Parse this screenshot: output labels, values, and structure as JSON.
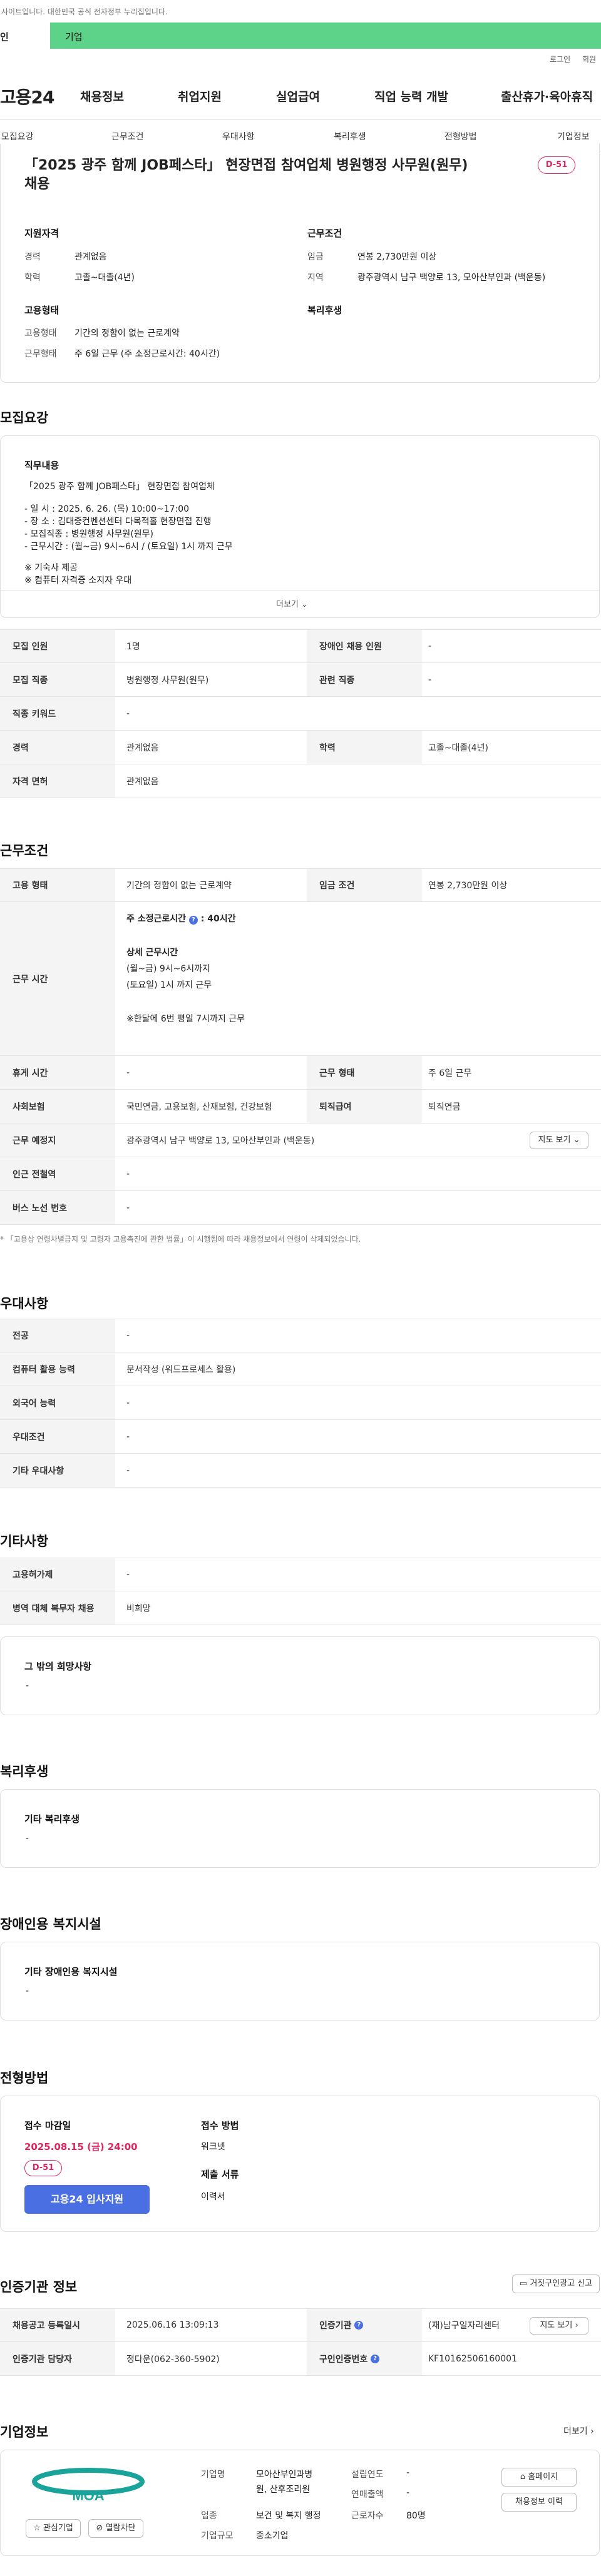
{
  "top": {
    "notice": "사이트입니다. 대한민국 공식 전자정부 누리집입니다.",
    "tab_person": "인",
    "tab_corp": "기업",
    "login": "로그인",
    "join": "회원"
  },
  "gnb": {
    "logo": "고용24",
    "items": [
      "채용정보",
      "취업지원",
      "실업급여",
      "직업 능력 개발",
      "출산휴가·육아휴직"
    ]
  },
  "subnav": [
    "모집요강",
    "근무조건",
    "우대사항",
    "복리후생",
    "전형방법",
    "기업정보"
  ],
  "header": {
    "title_line1": "「2025 광주 함께 JOB페스타」 현장면접 참여업체 병원행정 사무원(원무)",
    "title_line2": "채용",
    "dday": "D-51",
    "qual_head": "지원자격",
    "cond_head": "근무조건",
    "career_lbl": "경력",
    "career_val": "관계없음",
    "edu_lbl": "학력",
    "edu_val": "고졸~대졸(4년)",
    "wage_lbl": "임금",
    "wage_val": "연봉 2,730만원 이상",
    "region_lbl": "지역",
    "region_val": "광주광역시 남구 백양로 13, 모아산부인과 (백운동)",
    "emp_head": "고용형태",
    "welfare_head": "복리후생",
    "emptype_lbl": "고용형태",
    "emptype_val": "기간의 정함이 없는 근로계약",
    "worktype_lbl": "근무형태",
    "worktype_val": "주 6일 근무 (주 소정근로시간: 40시간)"
  },
  "recruit": {
    "title": "모집요강",
    "duty_head": "직무내용",
    "lines": [
      "「2025 광주 함께 JOB페스타」 현장면접 참여업체",
      "- 일    시 : 2025. 6. 26. (목) 10:00~17:00",
      "- 장    소 : 김대중컨벤션센터 다목적홀 현장면접 진행",
      "- 모집직종 : 병원행정 사무원(원무)",
      "- 근무시간 : (월~금) 9시~6시 / (토요일) 1시 까지 근무",
      "※ 기숙사 제공",
      "※ 컴퓨터 자격증 소지자 우대"
    ],
    "more": "더보기",
    "rows": [
      [
        "모집 인원",
        "1명",
        "장애인 채용 인원",
        "-"
      ],
      [
        "모집 직종",
        "병원행정 사무원(원무)",
        "관련 직종",
        "-"
      ],
      [
        "직종 키워드",
        "-",
        "",
        ""
      ],
      [
        "경력",
        "관계없음",
        "학력",
        "고졸~대졸(4년)"
      ],
      [
        "자격 면허",
        "관계없음",
        "",
        ""
      ]
    ]
  },
  "conditions": {
    "title": "근무조건",
    "emp_lbl": "고용 형태",
    "emp_val": "기간의 정함이 없는 근로계약",
    "wage_lbl": "임금 조건",
    "wage_val": "연봉 2,730만원 이상",
    "hours_lbl": "근무 시간",
    "hours_main": "주 소정근로시간",
    "hours_num": "40시간",
    "detail_head": "상세 근무시간",
    "detail_1": "(월~금) 9시~6시까지",
    "detail_2": "(토요일) 1시 까지 근무",
    "detail_3": "※한달에 6번 평일 7시까지 근무",
    "rest_lbl": "휴게 시간",
    "rest_val": "-",
    "form_lbl": "근무 형태",
    "form_val": "주 6일 근무",
    "ins_lbl": "사회보험",
    "ins_val": "국민연금, 고용보험, 산재보험, 건강보험",
    "ret_lbl": "퇴직급여",
    "ret_val": "퇴직연금",
    "place_lbl": "근무 예정지",
    "place_val": "광주광역시 남구 백양로 13, 모아산부인과 (백운동)",
    "map_btn": "지도 보기",
    "subway_lbl": "인근 전철역",
    "subway_val": "-",
    "bus_lbl": "버스 노선 번호",
    "bus_val": "-",
    "footnote": "「고용상 연령차별금지 및 고령자 고용촉진에 관한 법률」이 시행됨에 따라 채용정보에서 연령이 삭제되었습니다."
  },
  "prefer": {
    "title": "우대사항",
    "rows": [
      [
        "전공",
        "-"
      ],
      [
        "컴퓨터 활용 능력",
        "문서작성 (워드프로세스 활용)"
      ],
      [
        "외국어 능력",
        "-"
      ],
      [
        "우대조건",
        "-"
      ],
      [
        "기타 우대사항",
        "-"
      ]
    ]
  },
  "etc": {
    "title": "기타사항",
    "rows": [
      [
        "고용허가제",
        "-"
      ],
      [
        "병역 대체 복무자 채용",
        "비희망"
      ]
    ],
    "wish_head": "그 밖의 희망사항",
    "wish_val": "-"
  },
  "welfare": {
    "title": "복리후생",
    "head": "기타 복리후생",
    "val": "-"
  },
  "disabled": {
    "title": "장애인용 복지시설",
    "head": "기타 장애인용 복지시설",
    "val": "-"
  },
  "process": {
    "title": "전형방법",
    "deadline_head": "접수 마감일",
    "deadline_val": "2025.08.15 (금) 24:00",
    "dday": "D-51",
    "apply": "고용24 입사지원",
    "method_head": "접수 방법",
    "method_val": "워크넷",
    "doc_head": "제출 서류",
    "doc_val": "이력서"
  },
  "cert": {
    "title": "인증기관 정보",
    "report_btn": "거짓구인광고 신고",
    "reg_lbl": "채용공고 등록일시",
    "reg_val": "2025.06.16 13:09:13",
    "org_lbl": "인증기관",
    "org_val": "(재)남구일자리센터",
    "map_btn": "지도 보기",
    "mgr_lbl": "인증기관 담당자",
    "mgr_val": "정다운(062-360-5902)",
    "num_lbl": "구인인증번호",
    "num_val": "KF10162506160001"
  },
  "company": {
    "title": "기업정보",
    "more": "더보기",
    "logo_text": "MOA",
    "fav_btn": "관심기업",
    "block_btn": "열람차단",
    "type_lbl": "기업명",
    "type_val_1": "모아산부인과병",
    "type_val_2": "원, 산후조리원",
    "ind_lbl": "업종",
    "ind_val": "보건 및 복지 행정",
    "size_lbl": "기업규모",
    "size_val": "중소기업",
    "found_lbl": "설립연도",
    "found_val": "-",
    "rev_lbl": "연매출액",
    "rev_val": "-",
    "emp_lbl": "근로자수",
    "emp_val": "80명",
    "home_btn": "홈페이지",
    "jobs_btn": "채용정보 이력"
  },
  "colors": {
    "accent": "#5dd38a",
    "brand_blue": "#4a6fe3",
    "dday_red": "#e0245e"
  }
}
